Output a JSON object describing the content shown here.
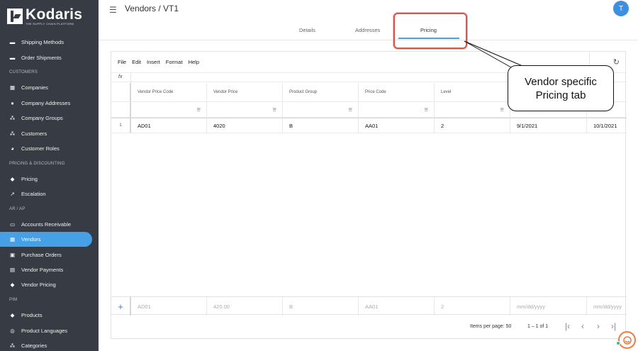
{
  "brand": {
    "name": "Kodaris",
    "tagline": "THE SUPPLY CHAIN PLATFORM"
  },
  "header": {
    "title": "Vendors / VT1",
    "avatar_initial": "T"
  },
  "tabs": [
    {
      "label": "Details",
      "active": false
    },
    {
      "label": "Addresses",
      "active": false
    },
    {
      "label": "Pricing",
      "active": true
    }
  ],
  "sidebar": {
    "items": [
      {
        "type": "item",
        "label": "Shipping Methods",
        "icon": "truck-icon",
        "glyph": "▬"
      },
      {
        "type": "item",
        "label": "Order Shipments",
        "icon": "truck-icon",
        "glyph": "▬"
      },
      {
        "type": "section",
        "label": "CUSTOMERS"
      },
      {
        "type": "item",
        "label": "Companies",
        "icon": "building-icon",
        "glyph": "▦"
      },
      {
        "type": "item",
        "label": "Company Addresses",
        "icon": "location-pin-icon",
        "glyph": "●"
      },
      {
        "type": "item",
        "label": "Company Groups",
        "icon": "group-icon",
        "glyph": "⁂"
      },
      {
        "type": "item",
        "label": "Customers",
        "icon": "people-icon",
        "glyph": "⁂"
      },
      {
        "type": "item",
        "label": "Customer Roles",
        "icon": "user-role-icon",
        "glyph": "◕"
      },
      {
        "type": "section",
        "label": "PRICING & DISCOUNTING"
      },
      {
        "type": "item",
        "label": "Pricing",
        "icon": "tag-icon",
        "glyph": "◆"
      },
      {
        "type": "item",
        "label": "Escalation",
        "icon": "trending-up-icon",
        "glyph": "↗"
      },
      {
        "type": "section",
        "label": "AR / AP"
      },
      {
        "type": "item",
        "label": "Accounts Receivable",
        "icon": "credit-card-icon",
        "glyph": "▭"
      },
      {
        "type": "item",
        "label": "Vendors",
        "icon": "store-icon",
        "glyph": "▦",
        "active": true
      },
      {
        "type": "item",
        "label": "Purchase Orders",
        "icon": "receipt-icon",
        "glyph": "▣"
      },
      {
        "type": "item",
        "label": "Vendor Payments",
        "icon": "payments-icon",
        "glyph": "▤"
      },
      {
        "type": "item",
        "label": "Vendor Pricing",
        "icon": "tag-icon",
        "glyph": "◆"
      },
      {
        "type": "section",
        "label": "PIM"
      },
      {
        "type": "item",
        "label": "Products",
        "icon": "tag-icon",
        "glyph": "◆"
      },
      {
        "type": "item",
        "label": "Product Languages",
        "icon": "globe-icon",
        "glyph": "◎"
      },
      {
        "type": "item",
        "label": "Categories",
        "icon": "category-icon",
        "glyph": "⁂"
      }
    ]
  },
  "sheet": {
    "menu": [
      "File",
      "Edit",
      "Insert",
      "Format",
      "Help"
    ],
    "fx_label": "fx",
    "columns": [
      "Vendor Price Code",
      "Vendor Price",
      "Product Group",
      "Price Code",
      "Level",
      "",
      ""
    ],
    "rows": [
      {
        "num": "1",
        "cells": [
          "AD01",
          "4020",
          "B",
          "AA01",
          "2",
          "9/1/2021",
          "10/1/2021"
        ]
      }
    ],
    "new_row": [
      "AD01",
      "420.00",
      "B",
      "AA01",
      "2",
      "mm/dd/yyyy",
      "mm/dd/yyyy"
    ],
    "pager": {
      "items_per_page": "Items per page: 50",
      "range": "1 – 1 of 1"
    }
  },
  "callout": {
    "text": "Vendor specific Pricing tab"
  },
  "colors": {
    "sidebar_bg": "#363b44",
    "accent": "#45a0e6",
    "highlight": "#d9534f"
  }
}
